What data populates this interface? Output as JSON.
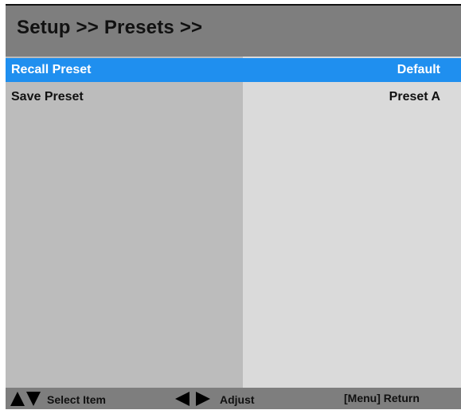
{
  "header": {
    "title": "Setup >> Presets >>"
  },
  "menu": {
    "items": [
      {
        "label": "Recall Preset",
        "value": "Default",
        "selected": true
      },
      {
        "label": "Save Preset",
        "value": "Preset A",
        "selected": false
      }
    ]
  },
  "footer": {
    "select_label": "Select Item",
    "adjust_label": "Adjust",
    "return_label": "[Menu] Return",
    "select_icons": [
      "arrow-up-icon",
      "arrow-down-icon"
    ],
    "adjust_icons": [
      "arrow-left-icon",
      "arrow-right-icon"
    ]
  },
  "colors": {
    "selection": "#1f8fef",
    "header_bar": "#7e7e7e",
    "left_column": "#bcbcbc",
    "right_column": "#dadada"
  }
}
